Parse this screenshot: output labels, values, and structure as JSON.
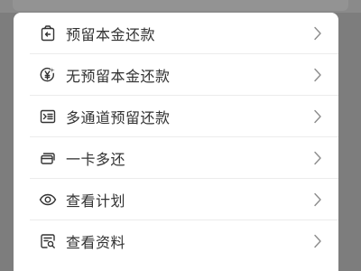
{
  "menu": {
    "items": [
      {
        "label": "预留本金还款",
        "icon": "bag-arrow-icon"
      },
      {
        "label": "无预留本金还款",
        "icon": "yen-refresh-icon"
      },
      {
        "label": "多通道预留还款",
        "icon": "card-channel-icon"
      },
      {
        "label": "一卡多还",
        "icon": "credit-card-icon"
      },
      {
        "label": "查看计划",
        "icon": "eye-icon"
      },
      {
        "label": "查看资料",
        "icon": "document-search-icon"
      }
    ]
  },
  "colors": {
    "backdrop": "#7d7d7d",
    "sheet": "#ffffff",
    "text": "#333333",
    "icon": "#333333",
    "chevron": "#8c8c8c",
    "divider": "#ececec"
  }
}
